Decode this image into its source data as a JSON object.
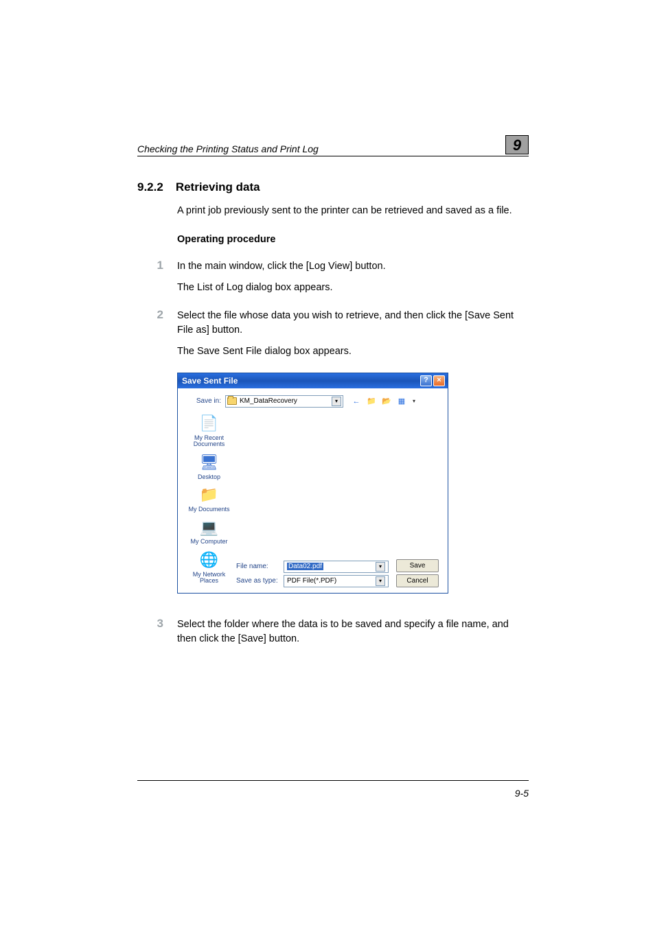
{
  "chapter_badge": "9",
  "running_header": "Checking the Printing Status and Print Log",
  "section_number": "9.2.2",
  "section_title": "Retrieving data",
  "intro": "A print job previously sent to the printer can be retrieved and saved as a file.",
  "operating_procedure_label": "Operating procedure",
  "steps": [
    {
      "num": "1",
      "text": "In the main window, click the [Log View] button.",
      "sub": "The List of Log dialog box appears."
    },
    {
      "num": "2",
      "text": "Select the file whose data you wish to retrieve, and then click the [Save Sent File as] button.",
      "sub": "The Save Sent File dialog box appears."
    },
    {
      "num": "3",
      "text": "Select the folder where the data is to be saved and specify a file name, and then click the [Save] button.",
      "sub": ""
    }
  ],
  "dialog": {
    "title": "Save Sent File",
    "help_btn": "?",
    "close_btn": "×",
    "save_in_label": "Save in:",
    "save_in_value": "KM_DataRecovery",
    "places": [
      {
        "label": "My Recent Documents"
      },
      {
        "label": "Desktop"
      },
      {
        "label": "My Documents"
      },
      {
        "label": "My Computer"
      },
      {
        "label": "My Network Places"
      }
    ],
    "file_name_label": "File name:",
    "file_name_value": "Data02.pdf",
    "save_as_type_label": "Save as type:",
    "save_as_type_value": "PDF File(*.PDF)",
    "save_btn": "Save",
    "cancel_btn": "Cancel"
  },
  "page_number": "9-5"
}
